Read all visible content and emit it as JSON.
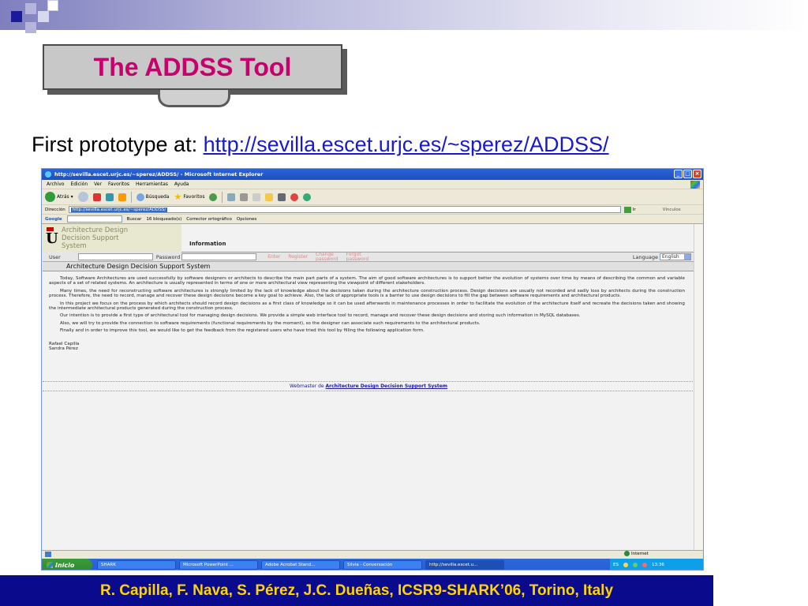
{
  "slide": {
    "title": "The ADDSS Tool",
    "subtitle_prefix": "First prototype at: ",
    "subtitle_url": "http://sevilla.escet.urjc.es/~sperez/ADDSS/",
    "footer": "R. Capilla, F. Nava, S. Pérez, J.C. Dueñas, ICSR9-SHARK’06, Torino, Italy"
  },
  "colors": {
    "title": "#c8006e",
    "footer_bg": "#0a0a8c",
    "footer_text": "#ffd400",
    "link": "#1a1acc"
  },
  "browser": {
    "window_title": "http://sevilla.escet.urjc.es/~sperez/ADDSS/ - Microsoft Internet Explorer",
    "menu": [
      "Archivo",
      "Edición",
      "Ver",
      "Favoritos",
      "Herramientas",
      "Ayuda"
    ],
    "toolbar": {
      "back": "Atrás",
      "search": "Búsqueda",
      "favorites": "Favoritos"
    },
    "address": {
      "label": "Dirección",
      "value": "http://sevilla.escet.urjc.es/~sperez/ADDSS/",
      "go": "Ir",
      "links": "Vínculos"
    },
    "google_bar": {
      "logo": "Google",
      "search": "Buscar",
      "blocked": "16 bloqueado(s)",
      "spell": "Corrector ortográfico",
      "options": "Opciones"
    },
    "status": {
      "zone": "Internet"
    },
    "taskbar": {
      "start": "Inicio",
      "tasks": [
        "SHARK",
        "Microsoft PowerPoint ...",
        "Adobe Acrobat Stand...",
        "Silvia - Conversación",
        "http://sevilla.escet.u..."
      ],
      "lang": "ES",
      "clock": "13:36"
    }
  },
  "site": {
    "logo_letter": "U",
    "logo_text": [
      "Architecture Design",
      "Decision Support",
      "System"
    ],
    "info_label": "Information",
    "user_label": "User",
    "password_label": "Password",
    "enter": "Enter",
    "register": "Register",
    "change_password": [
      "Change",
      "password"
    ],
    "forgot_password": [
      "Forgot",
      "password"
    ],
    "language_label": "Language",
    "language_value": "English",
    "page_title": "Architecture Design Decision Support System",
    "paragraphs": [
      "Today, Software Architectures are used successfully by software designers or architects to describe the main part parts of a system. The aim of good software architectures is to support better the evolution of systems over time by means of describing the common and variable aspects of a set of related systems. An architecture is usually represented in terms of one or more architectural view representing the viewpoint of different stakeholders.",
      "Many times, the need for reconstructing software architectures is strongly limited by the lack of knowledge about the decisions taken during the architecture construction process. Design decisions are usually not recorded and sadly loss by architects during the construction process. Therefore, the need to record, manage and recover these design decisions become a key goal to achieve. Also, the lack of appropriate tools is a barrier to use design decisions to fill the gap between software requirements and architectural products.",
      "In this project we focus on the process by which architects should record design decisions as a first class of knowledge so it can be used afterwards in maintenance processes in order to facilitate the evolution of the architecture itself and recreate the decisions taken and showing the intermediate architectural products generated during the construction process.",
      "Our intention is to provide a first type of architectural tool for managing design decisions. We provide a simple web interface tool to record, manage and recover these design decisions and storing such information in MySQL databases.",
      "Also, we will try to provide the connection to software requirements (functional requirements by the moment), so the designer can associate such requirements to the architectural products.",
      "Finally and in order to improve this tool, we would like to get the feedback from the registered users who have tried this tool by filling the following application form."
    ],
    "authors": [
      "Rafael Capilla",
      "Sandra Pérez"
    ],
    "webmaster_prefix": "Webmaster de ",
    "webmaster_link": "Architecture Design Decision Support System"
  }
}
